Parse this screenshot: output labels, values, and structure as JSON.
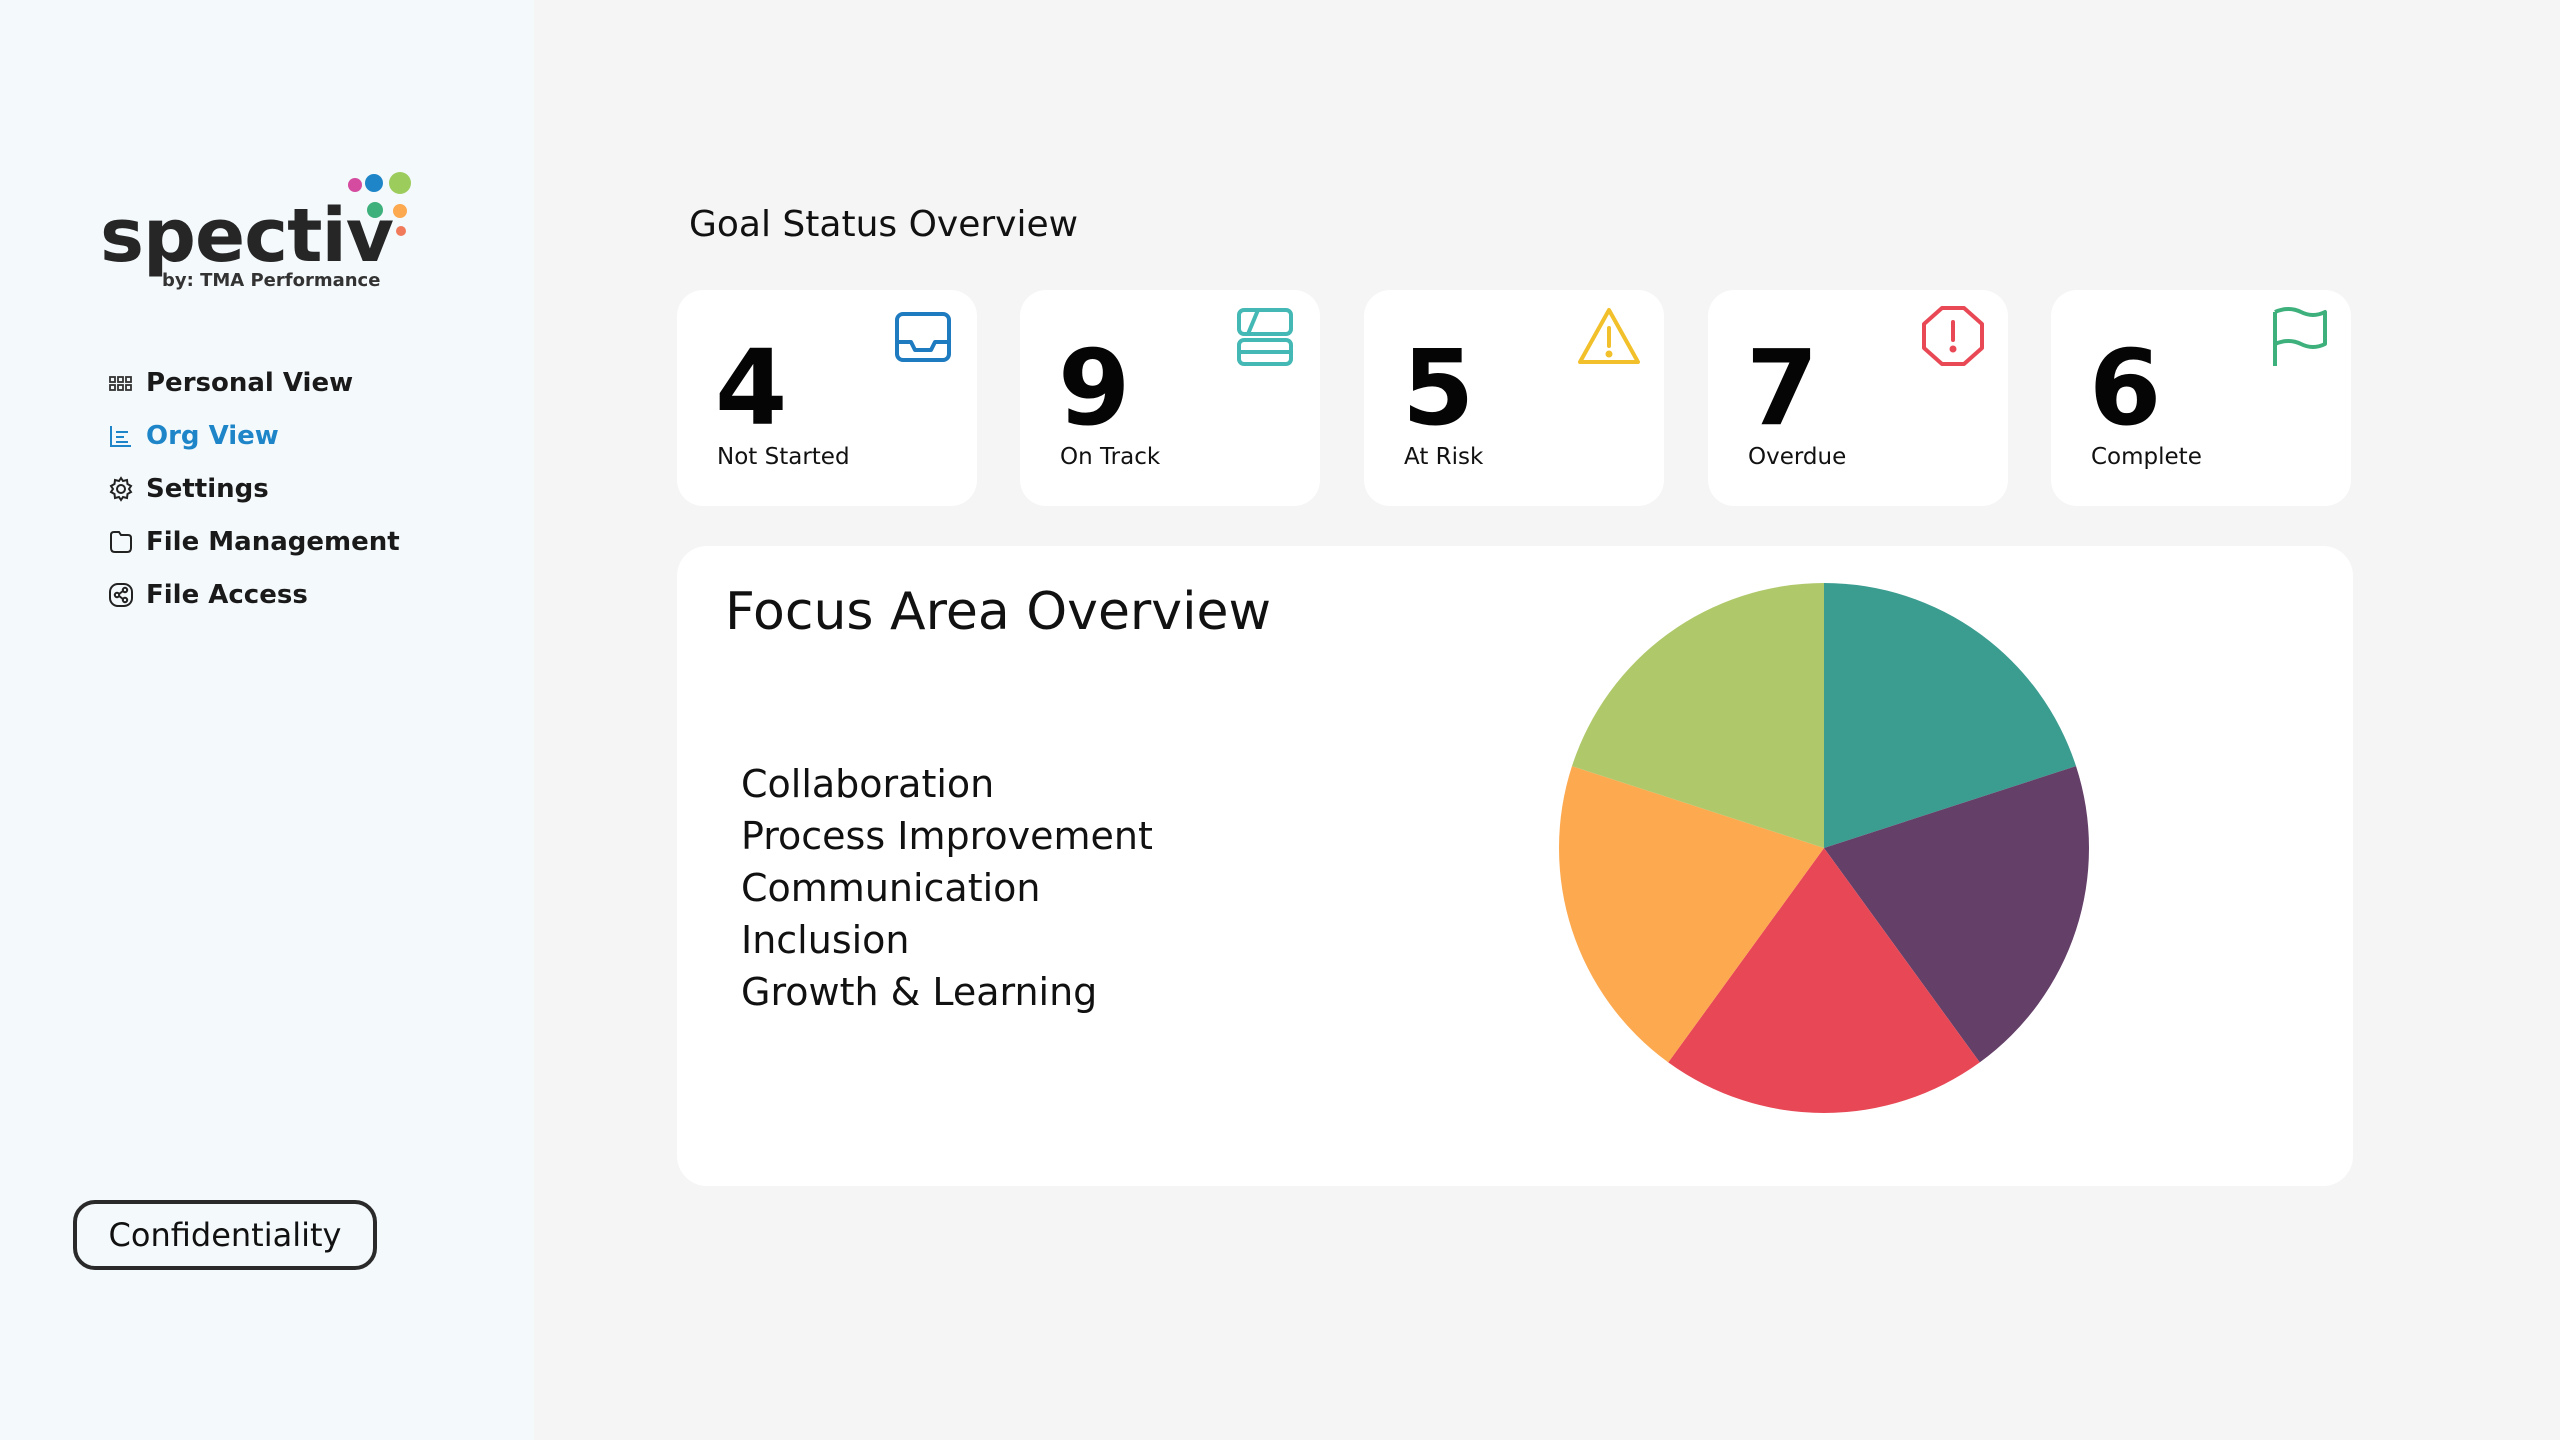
{
  "sidebar": {
    "logo": {
      "word": "spectiv",
      "sub": "by: TMA Performance"
    },
    "nav": [
      {
        "label": "Personal View",
        "icon": "grid-icon",
        "active": false
      },
      {
        "label": "Org View",
        "icon": "chart-icon",
        "active": true
      },
      {
        "label": "Settings",
        "icon": "gear-icon",
        "active": false
      },
      {
        "label": "File Management",
        "icon": "folder-icon",
        "active": false
      },
      {
        "label": "File Access",
        "icon": "share-icon",
        "active": false
      }
    ],
    "confidentiality_label": "Confidentiality"
  },
  "goal_status": {
    "title": "Goal Status Overview",
    "cards": [
      {
        "value": "4",
        "label": "Not Started",
        "icon": "inbox-icon",
        "color": "#1e7bc0"
      },
      {
        "value": "9",
        "label": "On Track",
        "icon": "layout-icon",
        "color": "#44b8b4"
      },
      {
        "value": "5",
        "label": "At Risk",
        "icon": "warning-icon",
        "color": "#f2c02b"
      },
      {
        "value": "7",
        "label": "Overdue",
        "icon": "alert-octagon-icon",
        "color": "#e94955"
      },
      {
        "value": "6",
        "label": "Complete",
        "icon": "flag-icon",
        "color": "#3db07c"
      }
    ]
  },
  "focus_area": {
    "title": "Focus Area Overview",
    "legend": [
      "Collaboration",
      "Process Improvement",
      "Communication",
      "Inclusion",
      "Growth & Learning"
    ]
  },
  "chart_data": {
    "type": "pie",
    "categories": [
      "Collaboration",
      "Process Improvement",
      "Communication",
      "Inclusion",
      "Growth & Learning"
    ],
    "values": [
      20,
      20,
      20,
      20,
      20
    ],
    "colors": [
      "#3b9c90",
      "#643f68",
      "#e84855",
      "#fda94f",
      "#afc96a"
    ]
  },
  "colors": {
    "accent": "#1e86c8",
    "sidebar_bg": "#f4f9fc",
    "page_bg": "#f5f5f5"
  }
}
